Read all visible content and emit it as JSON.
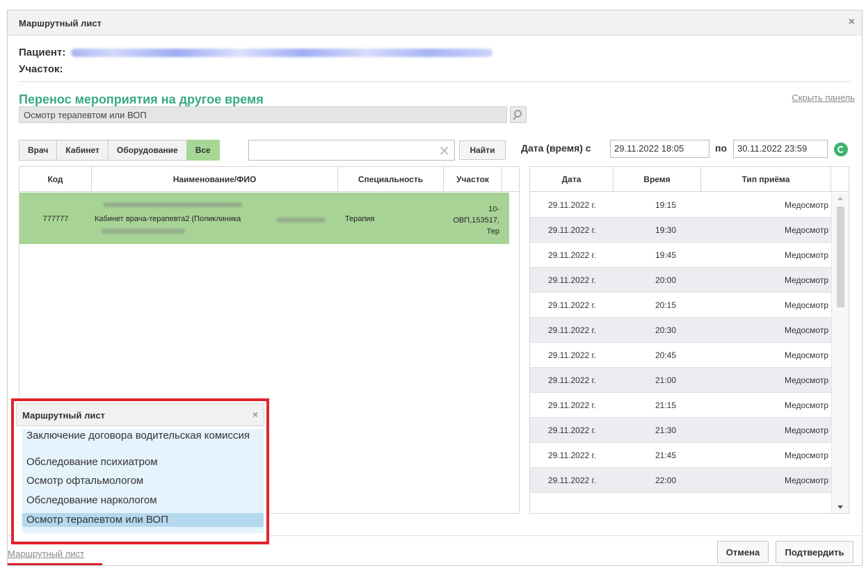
{
  "dialog": {
    "title": "Маршрутный лист",
    "close_icon": "close-icon"
  },
  "patient": {
    "label": "Пациент:",
    "district_label": "Участок:"
  },
  "section": {
    "title": "Перенос мероприятия на другое время",
    "hide_link": "Скрыть панель",
    "event_value": "Осмотр терапевтом или ВОП"
  },
  "filters": {
    "buttons": [
      "Врач",
      "Кабинет",
      "Оборудование",
      "Все"
    ],
    "active": "Все",
    "find_label": "Найти",
    "search_value": ""
  },
  "left_table": {
    "headers": [
      "Код",
      "Наименование/ФИО",
      "Специальность",
      "Участок"
    ],
    "rows": [
      {
        "code": "777777",
        "name": "Кабинет врача-терапевта2 (Поликлиника",
        "specialty": "Терапия",
        "district_lines": [
          "10-",
          "ОВП,153517,",
          "Тер"
        ]
      }
    ],
    "selected_row_color": "#a7d496"
  },
  "date_filter": {
    "label": "Дата (время) с",
    "from": "29.11.2022 18:05",
    "to_label": "по",
    "to": "30.11.2022 23:59",
    "refresh_icon": "refresh-icon",
    "accent_color": "#3db36d"
  },
  "right_table": {
    "headers": [
      "Дата",
      "Время",
      "Тип приёма"
    ],
    "rows": [
      {
        "date": "29.11.2022 г.",
        "time": "19:15",
        "type": "Медосмотр"
      },
      {
        "date": "29.11.2022 г.",
        "time": "19:30",
        "type": "Медосмотр"
      },
      {
        "date": "29.11.2022 г.",
        "time": "19:45",
        "type": "Медосмотр"
      },
      {
        "date": "29.11.2022 г.",
        "time": "20:00",
        "type": "Медосмотр"
      },
      {
        "date": "29.11.2022 г.",
        "time": "20:15",
        "type": "Медосмотр"
      },
      {
        "date": "29.11.2022 г.",
        "time": "20:30",
        "type": "Медосмотр"
      },
      {
        "date": "29.11.2022 г.",
        "time": "20:45",
        "type": "Медосмотр"
      },
      {
        "date": "29.11.2022 г.",
        "time": "21:00",
        "type": "Медосмотр"
      },
      {
        "date": "29.11.2022 г.",
        "time": "21:15",
        "type": "Медосмотр"
      },
      {
        "date": "29.11.2022 г.",
        "time": "21:30",
        "type": "Медосмотр"
      },
      {
        "date": "29.11.2022 г.",
        "time": "21:45",
        "type": "Медосмотр"
      },
      {
        "date": "29.11.2022 г.",
        "time": "22:00",
        "type": "Медосмотр"
      }
    ]
  },
  "popup": {
    "title": "Маршрутный лист",
    "items": [
      "Заключение договора водительская комиссия",
      "Обследование психиатром",
      "Осмотр офтальмологом",
      "Обследование наркологом",
      "Осмотр терапевтом или ВОП"
    ],
    "selected_index": 4,
    "highlight_color": "#e0242c"
  },
  "footer": {
    "link": "Маршрутный лист",
    "cancel": "Отмена",
    "confirm": "Подтвердить"
  }
}
